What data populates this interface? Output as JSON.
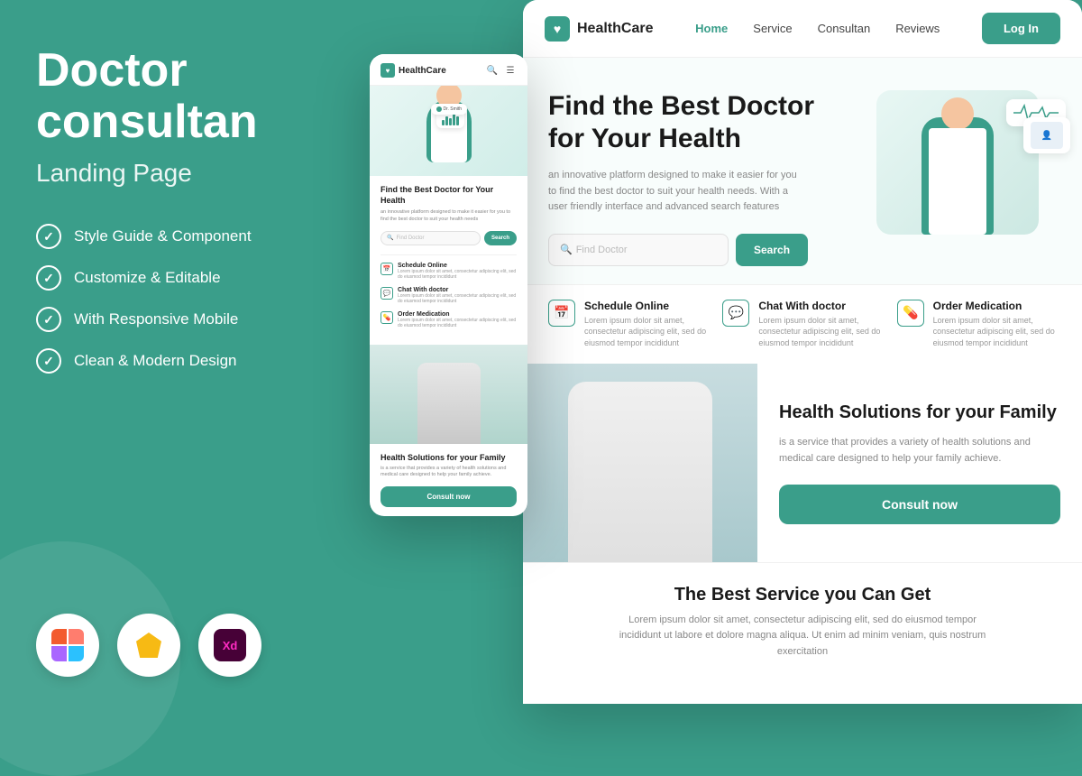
{
  "left": {
    "title_line1": "Doctor",
    "title_line2": "consultan",
    "subtitle": "Landing Page",
    "features": [
      "Style Guide & Component",
      "Customize & Editable",
      "With Responsive Mobile",
      "Clean & Modern Design"
    ],
    "tools": [
      "Figma",
      "Sketch",
      "Adobe XD"
    ]
  },
  "mobile": {
    "logo": "HealthCare",
    "hero_title": "Find the Best Doctor for Your Health",
    "hero_desc": "an innovative platform designed to make it easier for you to find the best doctor to suit your health needs",
    "search_placeholder": "Find Doctor",
    "search_btn": "Search",
    "features": [
      {
        "icon": "📅",
        "title": "Schedule Online",
        "desc": "Lorem ipsum dolor sit amet, consectetur adipiscing elit, sed do eiusmod tempor incididunt"
      },
      {
        "icon": "💬",
        "title": "Chat With doctor",
        "desc": "Lorem ipsum dolor sit amet, consectetur adipiscing elit, sed do eiusmod tempor incididunt"
      },
      {
        "icon": "💊",
        "title": "Order Medication",
        "desc": "Lorem ipsum dolor sit amet, consectetur adipiscing elit, sed do eiusmod tempor incididunt"
      }
    ],
    "family_title": "Health Solutions for your Family",
    "family_desc": "is a service that provides a variety of health solutions and medical care designed to help your family achieve.",
    "consult_btn": "Consult now"
  },
  "desktop": {
    "logo": "HealthCare",
    "nav": [
      "Home",
      "Service",
      "Consultan",
      "Reviews"
    ],
    "nav_active": "Home",
    "login_btn": "Log In",
    "hero_title_line1": "Find the Best Doctor",
    "hero_title_line2": "for Your Health",
    "hero_desc": "an innovative platform designed to make it easier for you to find the best doctor to suit your health needs. With a user friendly interface and advanced search features",
    "search_placeholder": "Find Doctor",
    "search_btn": "Search",
    "features": [
      {
        "icon": "📅",
        "title": "Schedule Online",
        "desc": "Lorem ipsum dolor sit amet, consectetur adipiscing elit, sed do eiusmod tempor incididunt"
      },
      {
        "icon": "💬",
        "title": "Chat With doctor",
        "desc": "Lorem ipsum dolor sit amet, consectetur adipiscing elit, sed do eiusmod tempor incididunt"
      },
      {
        "icon": "💊",
        "title": "Order Medication",
        "desc": "Lorem ipsum dolor sit amet, consectetur adipiscing elit, sed do eiusmod tempor incididunt"
      }
    ],
    "health_title": "Health Solutions for your Family",
    "health_desc": "is a service that provides a variety of health solutions and medical care designed to help your family achieve.",
    "consult_btn": "Consult now",
    "service_title": "The Best Service you Can Get",
    "service_desc": "Lorem ipsum dolor sit amet, consectetur adipiscing elit, sed do eiusmod tempor incididunt ut labore et dolore magna aliqua. Ut enim ad minim veniam, quis nostrum exercitation"
  },
  "colors": {
    "primary": "#3a9e8a",
    "white": "#ffffff",
    "dark": "#1a1a1a",
    "gray": "#888888"
  }
}
